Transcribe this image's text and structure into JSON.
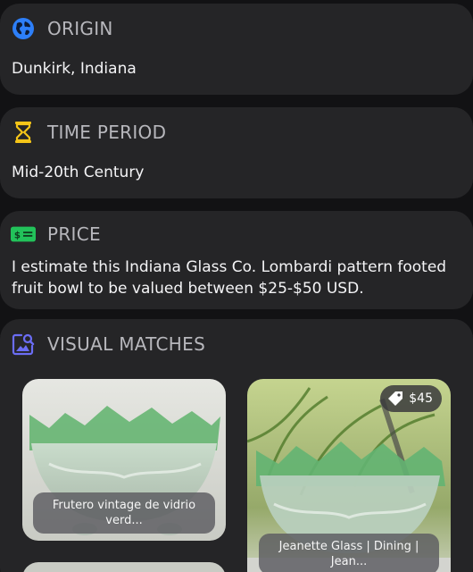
{
  "origin": {
    "title": "ORIGIN",
    "value": "Dunkirk, Indiana",
    "icon": "globe-icon",
    "color": "#2d7ff9"
  },
  "time_period": {
    "title": "TIME PERIOD",
    "value": "Mid-20th Century",
    "icon": "hourglass-icon",
    "color": "#f5c518"
  },
  "price": {
    "title": "PRICE",
    "value": "I estimate this Indiana Glass Co. Lombardi pattern footed fruit bowl to be valued between $25-$50 USD.",
    "icon": "money-icon",
    "color": "#22c25a"
  },
  "visual_matches": {
    "title": "VISUAL MATCHES",
    "icon": "image-search-icon",
    "color": "#6b6df5",
    "items": [
      {
        "caption": "Frutero vintage de vidrio verd...",
        "price": ""
      },
      {
        "caption": "Jeanette Glass | Dining | Jean...",
        "price": "$45"
      }
    ]
  }
}
